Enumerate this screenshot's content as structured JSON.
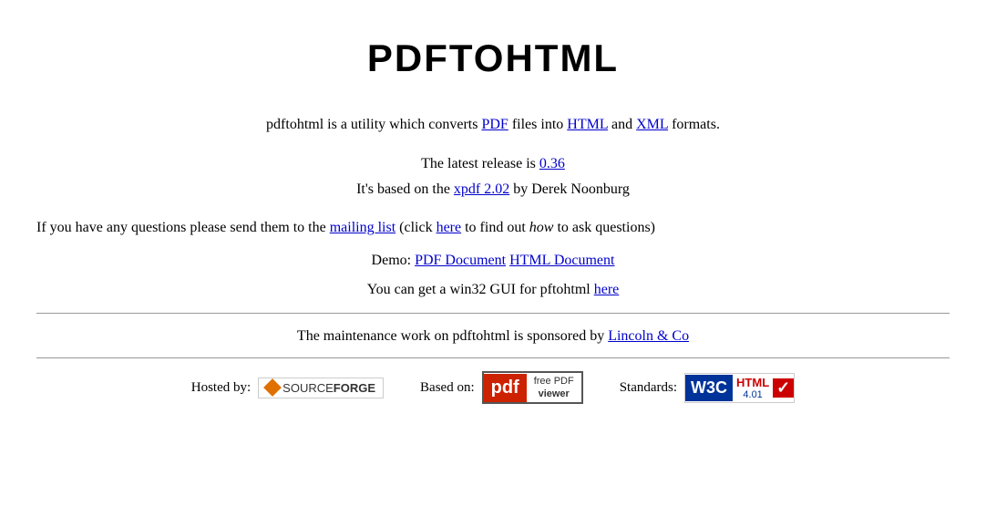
{
  "title": "PDFTOHTML",
  "description": {
    "prefix": "pdftohtml is a utility which converts ",
    "pdf_link_text": "PDF",
    "pdf_link_href": "#",
    "middle1": " files into ",
    "html_link_text": "HTML",
    "html_link_href": "#",
    "and": " and ",
    "xml_link_text": "XML",
    "xml_link_href": "#",
    "suffix": " formats."
  },
  "release": {
    "line1_prefix": "The latest release is ",
    "release_link_text": "0.36",
    "release_link_href": "#",
    "line2_prefix": "It's based on the ",
    "xpdf_link_text": "xpdf 2.02",
    "xpdf_link_href": "#",
    "line2_suffix": " by Derek Noonburg"
  },
  "questions": {
    "prefix": "If you have any questions please send them to the ",
    "mailing_list_text": "mailing list",
    "mailing_list_href": "#",
    "middle": " (click ",
    "here_text": "here",
    "here_href": "#",
    "middle2": " to find out ",
    "how_text": "how",
    "suffix": " to ask questions)"
  },
  "demo": {
    "prefix": "Demo: ",
    "pdf_doc_text": "PDF Document",
    "pdf_doc_href": "#",
    "space": " ",
    "html_doc_text": "HTML Document",
    "html_doc_href": "#"
  },
  "win32": {
    "prefix": "You can get a win32 GUI for pftohtml ",
    "here_text": "here",
    "here_href": "#"
  },
  "sponsor": {
    "prefix": "The maintenance work on pdftohtml is sponsored by ",
    "link_text": "Lincoln & Co",
    "link_href": "#"
  },
  "footer": {
    "hosted_by_label": "Hosted by:",
    "based_on_label": "Based on:",
    "standards_label": "Standards:",
    "sf_source": "SOURCE",
    "sf_forge": "FORGE",
    "pdf_free": "free PDF",
    "pdf_viewer": "viewer",
    "pdf_letter": "pdf",
    "w3c_text": "W3C",
    "html_text": "HTML",
    "version_text": "4.01"
  }
}
